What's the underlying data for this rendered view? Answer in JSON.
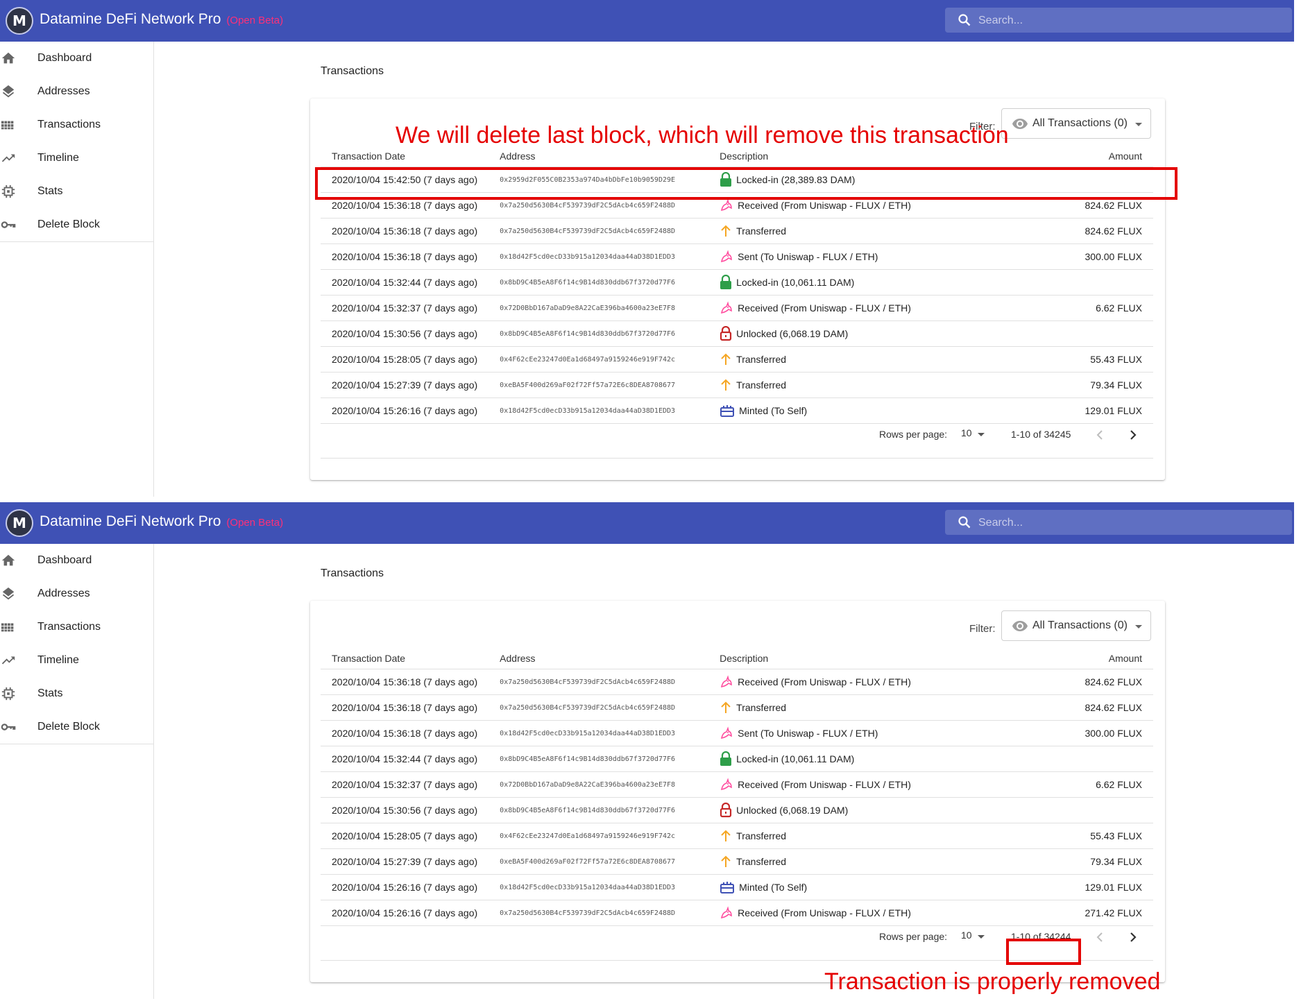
{
  "app": {
    "title": "Datamine DeFi Network Pro",
    "beta": "(Open Beta)",
    "logo": "M",
    "search_placeholder": "Search..."
  },
  "nav": [
    {
      "label": "Dashboard",
      "icon": "home-icon"
    },
    {
      "label": "Addresses",
      "icon": "layers-icon"
    },
    {
      "label": "Transactions",
      "icon": "grid-icon"
    },
    {
      "label": "Timeline",
      "icon": "trending-up-icon"
    },
    {
      "label": "Stats",
      "icon": "chip-icon"
    },
    {
      "label": "Delete Block",
      "icon": "key-icon"
    }
  ],
  "page_title": "Transactions",
  "filter": {
    "label": "Filter:",
    "value": "All Transactions (0)"
  },
  "columns": {
    "date": "Transaction Date",
    "address": "Address",
    "description": "Description",
    "amount": "Amount"
  },
  "pager": {
    "rows_per_page_label": "Rows per page:",
    "rows_per_page": "10"
  },
  "colors": {
    "appbar": "#3f51b5",
    "beta": "#ff2f78",
    "annotation": "#e50000",
    "lock": "#2e9e49",
    "unlock": "#c62828",
    "transfer": "#f5a623",
    "uniswap": "#ff4fa0",
    "minted": "#3f51b5"
  },
  "screens": [
    {
      "range": "1-10 of 34245",
      "annotation": "We will delete last block, which will remove this transaction",
      "rows": [
        {
          "date": "2020/10/04 15:42:50 (7 days ago)",
          "address": "0x2959d2F055C0B2353a974Da4bDbFe10b9059D29E",
          "icon": "lock-icon",
          "description": "Locked-in (28,389.83 DAM)",
          "amount": ""
        },
        {
          "date": "2020/10/04 15:36:18 (7 days ago)",
          "address": "0x7a250d5630B4cF539739dF2C5dAcb4c659F2488D",
          "icon": "unicorn-icon",
          "description": "Received (From Uniswap - FLUX / ETH)",
          "amount": "824.62 FLUX"
        },
        {
          "date": "2020/10/04 15:36:18 (7 days ago)",
          "address": "0x7a250d5630B4cF539739dF2C5dAcb4c659F2488D",
          "icon": "arrow-up-icon",
          "description": "Transferred",
          "amount": "824.62 FLUX"
        },
        {
          "date": "2020/10/04 15:36:18 (7 days ago)",
          "address": "0x18d42F5cd0ecD33b915a12034daa44aD38D1EDD3",
          "icon": "unicorn-icon",
          "description": "Sent (To Uniswap - FLUX / ETH)",
          "amount": "300.00 FLUX"
        },
        {
          "date": "2020/10/04 15:32:44 (7 days ago)",
          "address": "0x8bD9C4B5eA8F6f14c9B14d830ddb67f3720d77F6",
          "icon": "lock-icon",
          "description": "Locked-in (10,061.11 DAM)",
          "amount": ""
        },
        {
          "date": "2020/10/04 15:32:37 (7 days ago)",
          "address": "0x72D0BbD167aDaD9e8A22CaE396ba4600a23eE7F8",
          "icon": "unicorn-icon",
          "description": "Received (From Uniswap - FLUX / ETH)",
          "amount": "6.62 FLUX"
        },
        {
          "date": "2020/10/04 15:30:56 (7 days ago)",
          "address": "0x8bD9C4B5eA8F6f14c9B14d830ddb67f3720d77F6",
          "icon": "unlock-icon",
          "description": "Unlocked (6,068.19 DAM)",
          "amount": ""
        },
        {
          "date": "2020/10/04 15:28:05 (7 days ago)",
          "address": "0x4F62cEe23247d0Ea1d68497a9159246e919F742c",
          "icon": "arrow-up-icon",
          "description": "Transferred",
          "amount": "55.43 FLUX"
        },
        {
          "date": "2020/10/04 15:27:39 (7 days ago)",
          "address": "0xeBA5F400d269aF02f72Ff57a72E6c8DEA8708677",
          "icon": "arrow-up-icon",
          "description": "Transferred",
          "amount": "79.34 FLUX"
        },
        {
          "date": "2020/10/04 15:26:16 (7 days ago)",
          "address": "0x18d42F5cd0ecD33b915a12034daa44aD38D1EDD3",
          "icon": "minted-icon",
          "description": "Minted (To Self)",
          "amount": "129.01 FLUX"
        }
      ]
    },
    {
      "range": "1-10 of 34244",
      "annotation": "Transaction is properly removed",
      "rows": [
        {
          "date": "2020/10/04 15:36:18 (7 days ago)",
          "address": "0x7a250d5630B4cF539739dF2C5dAcb4c659F2488D",
          "icon": "unicorn-icon",
          "description": "Received (From Uniswap - FLUX / ETH)",
          "amount": "824.62 FLUX"
        },
        {
          "date": "2020/10/04 15:36:18 (7 days ago)",
          "address": "0x7a250d5630B4cF539739dF2C5dAcb4c659F2488D",
          "icon": "arrow-up-icon",
          "description": "Transferred",
          "amount": "824.62 FLUX"
        },
        {
          "date": "2020/10/04 15:36:18 (7 days ago)",
          "address": "0x18d42F5cd0ecD33b915a12034daa44aD38D1EDD3",
          "icon": "unicorn-icon",
          "description": "Sent (To Uniswap - FLUX / ETH)",
          "amount": "300.00 FLUX"
        },
        {
          "date": "2020/10/04 15:32:44 (7 days ago)",
          "address": "0x8bD9C4B5eA8F6f14c9B14d830ddb67f3720d77F6",
          "icon": "lock-icon",
          "description": "Locked-in (10,061.11 DAM)",
          "amount": ""
        },
        {
          "date": "2020/10/04 15:32:37 (7 days ago)",
          "address": "0x72D0BbD167aDaD9e8A22CaE396ba4600a23eE7F8",
          "icon": "unicorn-icon",
          "description": "Received (From Uniswap - FLUX / ETH)",
          "amount": "6.62 FLUX"
        },
        {
          "date": "2020/10/04 15:30:56 (7 days ago)",
          "address": "0x8bD9C4B5eA8F6f14c9B14d830ddb67f3720d77F6",
          "icon": "unlock-icon",
          "description": "Unlocked (6,068.19 DAM)",
          "amount": ""
        },
        {
          "date": "2020/10/04 15:28:05 (7 days ago)",
          "address": "0x4F62cEe23247d0Ea1d68497a9159246e919F742c",
          "icon": "arrow-up-icon",
          "description": "Transferred",
          "amount": "55.43 FLUX"
        },
        {
          "date": "2020/10/04 15:27:39 (7 days ago)",
          "address": "0xeBA5F400d269aF02f72Ff57a72E6c8DEA8708677",
          "icon": "arrow-up-icon",
          "description": "Transferred",
          "amount": "79.34 FLUX"
        },
        {
          "date": "2020/10/04 15:26:16 (7 days ago)",
          "address": "0x18d42F5cd0ecD33b915a12034daa44aD38D1EDD3",
          "icon": "minted-icon",
          "description": "Minted (To Self)",
          "amount": "129.01 FLUX"
        },
        {
          "date": "2020/10/04 15:26:16 (7 days ago)",
          "address": "0x7a250d5630B4cF539739dF2C5dAcb4c659F2488D",
          "icon": "unicorn-icon",
          "description": "Received (From Uniswap - FLUX / ETH)",
          "amount": "271.42 FLUX"
        }
      ]
    }
  ]
}
